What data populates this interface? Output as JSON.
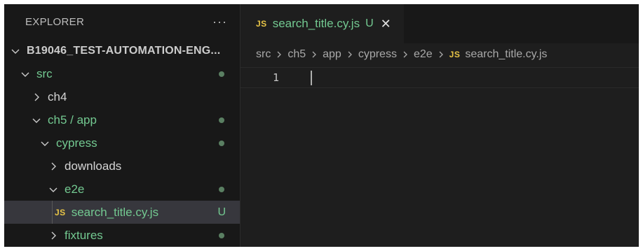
{
  "explorer": {
    "title": "EXPLORER",
    "more_icon": "···",
    "project_root": "B19046_TEST-AUTOMATION-ENG...",
    "items": [
      {
        "label": "src",
        "status": "dot",
        "state": "expanded",
        "color": "green"
      },
      {
        "label": "ch4",
        "state": "collapsed",
        "color": "default"
      },
      {
        "label": "ch5 / app",
        "status": "dot",
        "state": "expanded",
        "color": "green"
      },
      {
        "label": "cypress",
        "status": "dot",
        "state": "expanded",
        "color": "green"
      },
      {
        "label": "downloads",
        "state": "collapsed",
        "color": "default"
      },
      {
        "label": "e2e",
        "status": "dot",
        "state": "expanded",
        "color": "green"
      },
      {
        "label": "search_title.cy.js",
        "icon": "JS",
        "status": "U",
        "selected": true,
        "color": "green"
      },
      {
        "label": "fixtures",
        "status": "dot",
        "state": "collapsed",
        "color": "green"
      }
    ]
  },
  "editor": {
    "tab": {
      "icon": "JS",
      "title": "search_title.cy.js",
      "status": "U",
      "close": "✕"
    },
    "breadcrumb": {
      "parts": [
        "src",
        "ch5",
        "app",
        "cypress",
        "e2e"
      ],
      "file_icon": "JS",
      "file": "search_title.cy.js"
    },
    "lines": [
      {
        "number": "1",
        "content": ""
      }
    ]
  },
  "colors": {
    "modified_green": "#73c991",
    "js_yellow": "#e8c547",
    "status_dot": "#5a7f62",
    "sidebar_bg": "#181818",
    "editor_bg": "#1e1e1e",
    "selection_bg": "#37373d"
  },
  "icons": {
    "expanded": "chevron-down-icon",
    "collapsed": "chevron-right-icon",
    "more": "more-icon",
    "close": "close-icon",
    "javascript": "js-file-icon",
    "breadcrumb_separator": "chevron-right-icon"
  }
}
